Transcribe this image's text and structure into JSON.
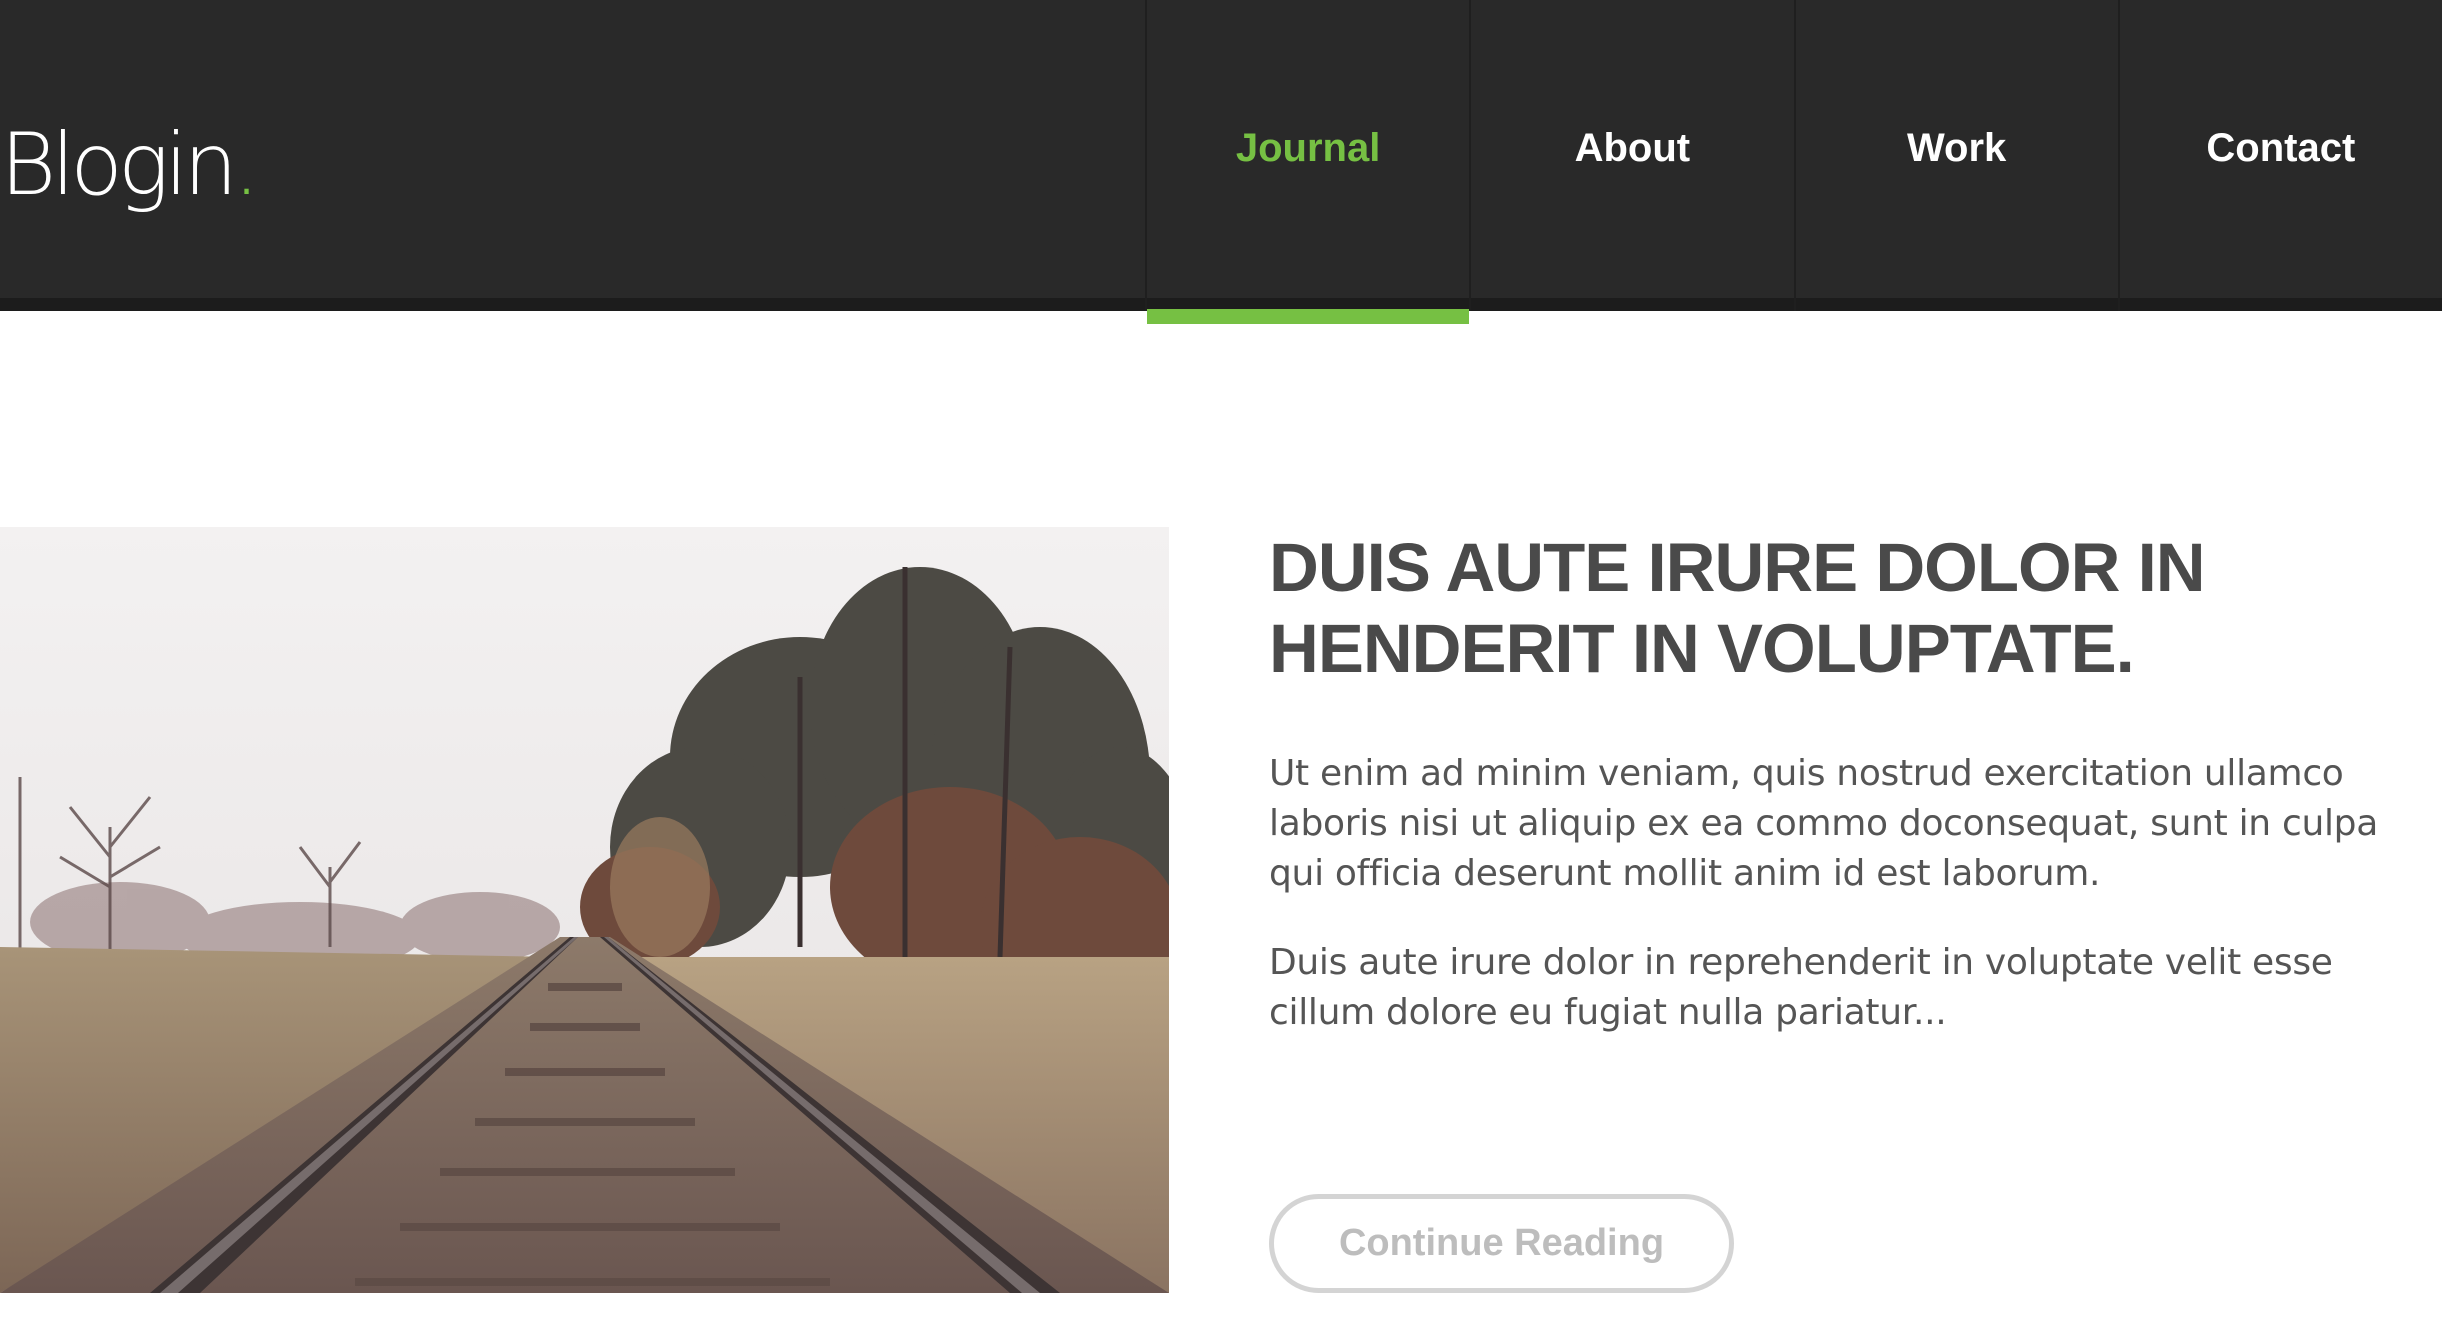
{
  "header": {
    "logo_text": "Blogin",
    "logo_dot": ".",
    "colors": {
      "background": "#292929",
      "accent": "#76c043"
    }
  },
  "nav": {
    "items": [
      {
        "label": "Journal",
        "active": true
      },
      {
        "label": "About",
        "active": false
      },
      {
        "label": "Work",
        "active": false
      },
      {
        "label": "Contact",
        "active": false
      }
    ]
  },
  "post": {
    "image_subject": "railroad-tracks-photo",
    "title": "DUIS AUTE IRURE DOLOR IN HENDERIT IN VOLUPTATE.",
    "paragraphs": [
      "Ut enim ad minim veniam, quis nostrud exercitation ullamco laboris nisi ut aliquip ex ea commo doconsequat, sunt in culpa qui officia deserunt mollit anim id est laborum.",
      "Duis aute irure dolor in reprehenderit in voluptate velit esse cillum dolore eu fugiat nulla pariatur..."
    ],
    "continue_label": "Continue Reading"
  }
}
